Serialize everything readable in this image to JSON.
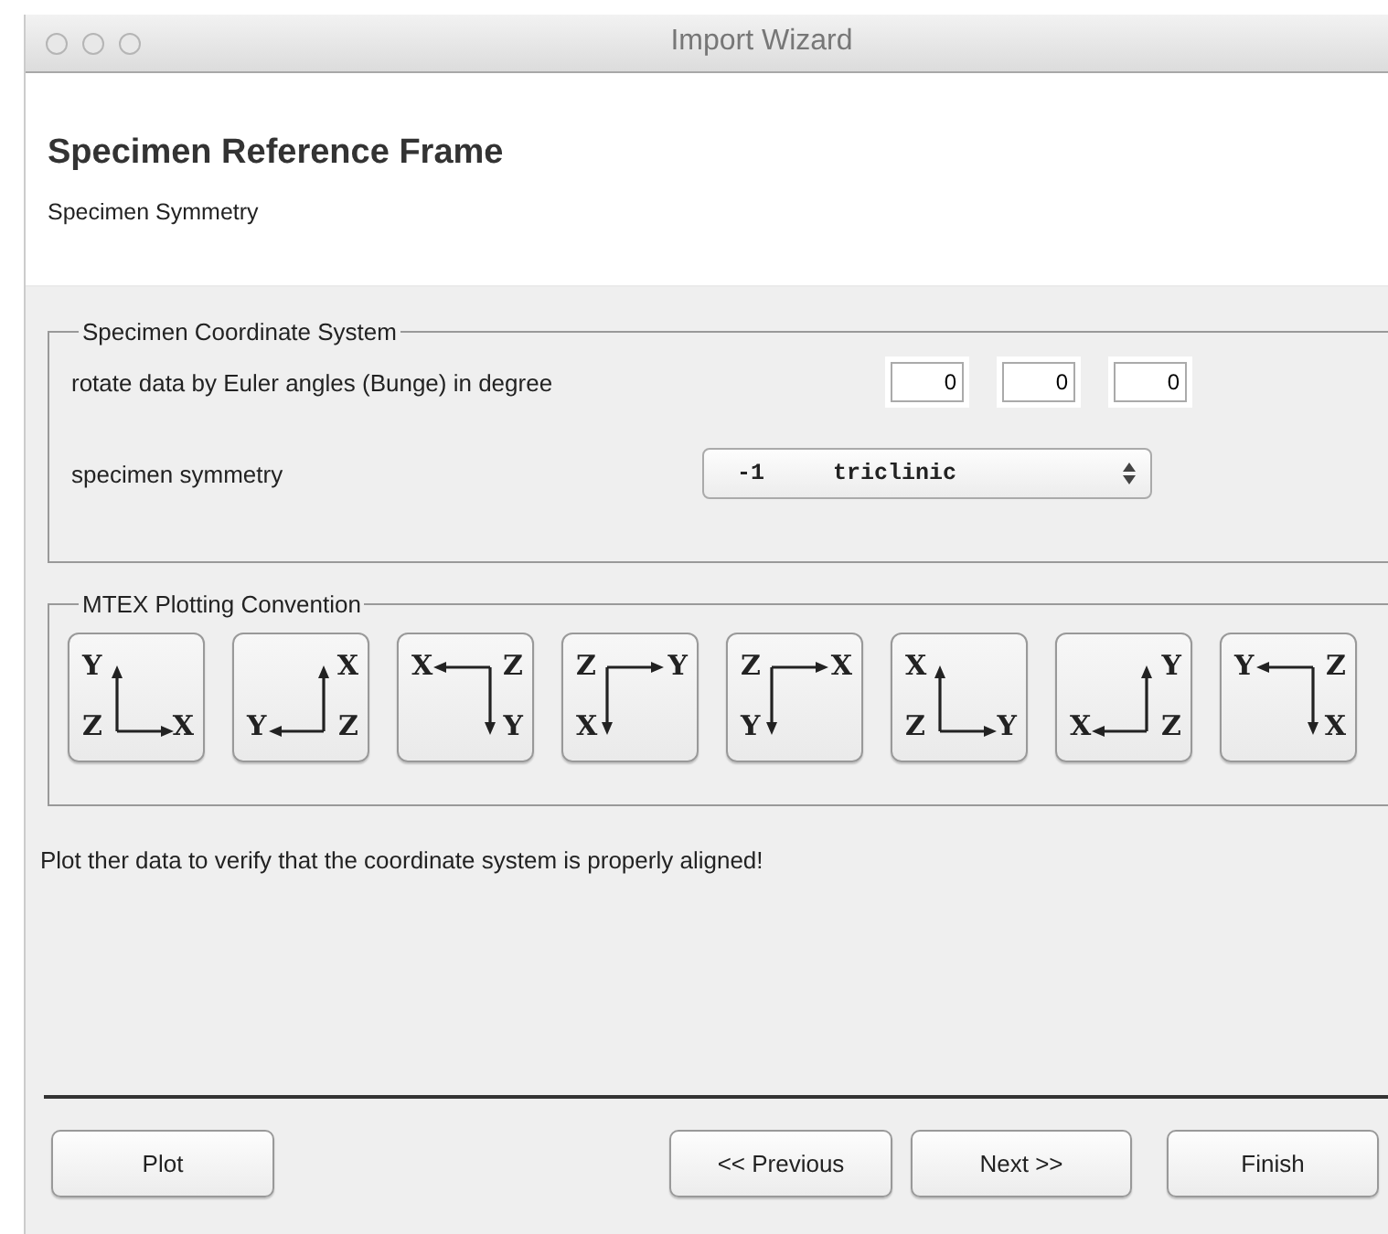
{
  "window": {
    "title": "Import Wizard"
  },
  "header": {
    "title": "Specimen Reference Frame",
    "subtitle": "Specimen Symmetry"
  },
  "coordinate_system": {
    "legend": "Specimen Coordinate System",
    "euler_label": "rotate data by Euler angles (Bunge) in degree",
    "euler_angles": [
      "0",
      "0",
      "0"
    ],
    "symmetry_label": "specimen symmetry",
    "symmetry_value": "-1     triclinic"
  },
  "plotting_convention": {
    "legend": "MTEX Plotting Convention",
    "options": [
      {
        "kind": "southwest",
        "top_left": "Y",
        "bottom_left": "Z",
        "bottom_right": "X"
      },
      {
        "kind": "southeast",
        "top_right": "X",
        "bottom_left": "Y",
        "bottom_right": "Z"
      },
      {
        "kind": "northeast",
        "top_left": "X",
        "top_right": "Z",
        "bottom_right": "Y"
      },
      {
        "kind": "northwest",
        "top_left": "Z",
        "top_right": "Y",
        "bottom_left": "X"
      },
      {
        "kind": "northwest",
        "top_left": "Z",
        "top_right": "X",
        "bottom_left": "Y"
      },
      {
        "kind": "southwest",
        "top_left": "X",
        "bottom_left": "Z",
        "bottom_right": "Y"
      },
      {
        "kind": "southeast",
        "top_right": "Y",
        "bottom_left": "X",
        "bottom_right": "Z"
      },
      {
        "kind": "northeast",
        "top_left": "Y",
        "top_right": "Z",
        "bottom_right": "X"
      }
    ]
  },
  "message": "Plot ther data to verify that the coordinate system is properly aligned!",
  "buttons": {
    "plot": "Plot",
    "previous": "<< Previous",
    "next": "Next >>",
    "finish": "Finish"
  }
}
